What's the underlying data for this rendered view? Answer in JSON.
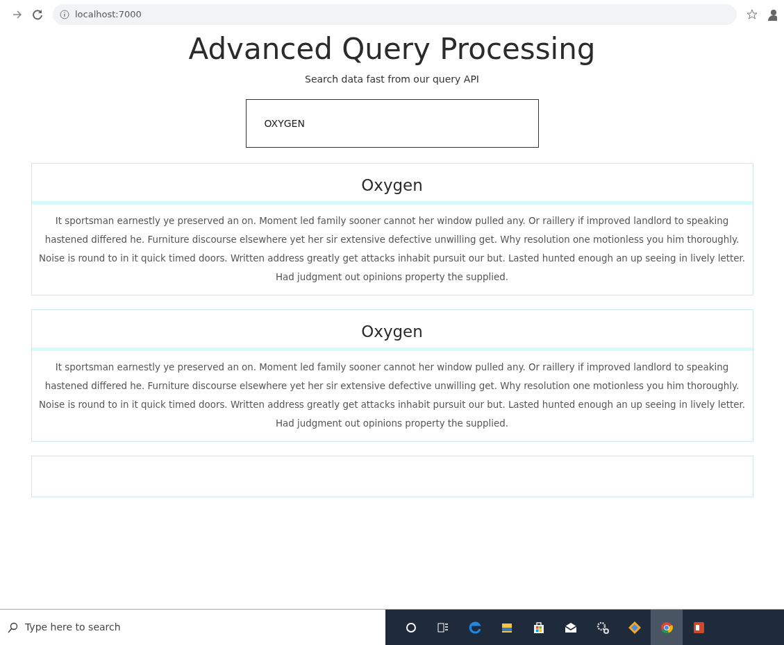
{
  "browser": {
    "url": "localhost:7000"
  },
  "header": {
    "title": "Advanced Query Processing",
    "subtitle": "Search data fast from our query API"
  },
  "search": {
    "value": "OXYGEN"
  },
  "results": [
    {
      "title": "Oxygen",
      "text": "It sportsman earnestly ye preserved an on. Moment led family sooner cannot her window pulled any. Or raillery if improved landlord to speaking hastened differed he. Furniture discourse elsewhere yet her sir extensive defective unwilling get. Why resolution one motionless you him thoroughly. Noise is round to in it quick timed doors. Written address greatly get attacks inhabit pursuit our but. Lasted hunted enough an up seeing in lively letter. Had judgment out opinions property the supplied."
    },
    {
      "title": "Oxygen",
      "text": "It sportsman earnestly ye preserved an on. Moment led family sooner cannot her window pulled any. Or raillery if improved landlord to speaking hastened differed he. Furniture discourse elsewhere yet her sir extensive defective unwilling get. Why resolution one motionless you him thoroughly. Noise is round to in it quick timed doors. Written address greatly get attacks inhabit pursuit our but. Lasted hunted enough an up seeing in lively letter. Had judgment out opinions property the supplied."
    }
  ],
  "taskbar": {
    "search_placeholder": "Type here to search",
    "apps": [
      {
        "kind": "cortana",
        "selected": false
      },
      {
        "kind": "taskview",
        "selected": false
      },
      {
        "kind": "edge",
        "selected": false
      },
      {
        "kind": "folder",
        "selected": false
      },
      {
        "kind": "store",
        "selected": false
      },
      {
        "kind": "mail",
        "selected": false
      },
      {
        "kind": "gears",
        "selected": false
      },
      {
        "kind": "diamond",
        "selected": false
      },
      {
        "kind": "chrome",
        "selected": true
      },
      {
        "kind": "slides",
        "selected": false
      }
    ]
  }
}
